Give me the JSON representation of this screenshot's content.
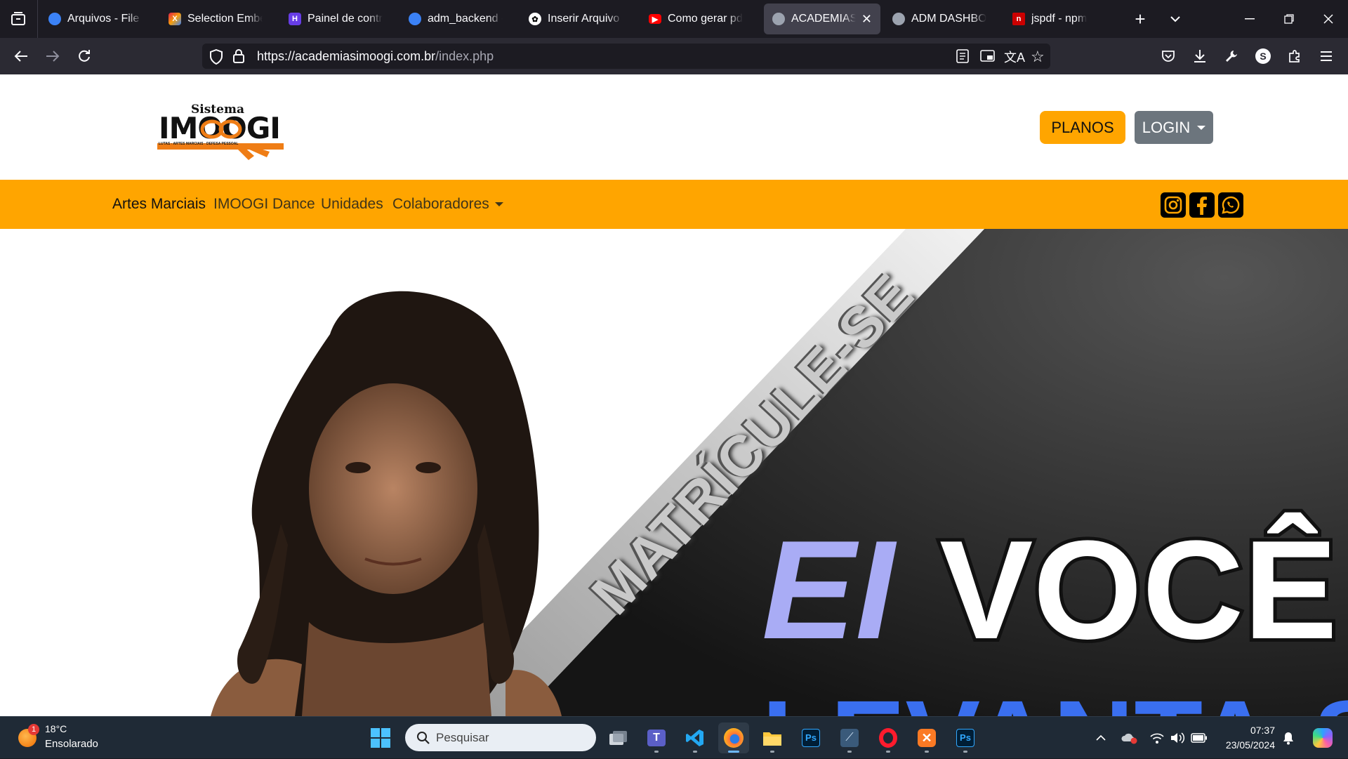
{
  "browser": {
    "tabs": [
      {
        "label": "Arquivos - File Bro",
        "favicon": "globe-icon",
        "color": "#3b82f6"
      },
      {
        "label": "Selection Embed",
        "favicon": "colorful-logo-icon",
        "color": "#e11d48"
      },
      {
        "label": "Painel de controle",
        "favicon": "h-logo-icon",
        "color": "#673de6"
      },
      {
        "label": "adm_backend - ac",
        "favicon": "globe-icon",
        "color": "#3b82f6"
      },
      {
        "label": "Inserir Arquivo Gr",
        "favicon": "openai-icon",
        "color": "#ffffff"
      },
      {
        "label": "Como gerar pdf c",
        "favicon": "youtube-icon",
        "color": "#ff0000"
      },
      {
        "label": "ACADEMIAS IM",
        "favicon": "earth-icon",
        "color": "#9ca3af",
        "active": true
      },
      {
        "label": "ADM DASHBOAR",
        "favicon": "earth-icon",
        "color": "#9ca3af"
      },
      {
        "label": "jspdf - npm",
        "favicon": "npm-icon",
        "color": "#cb0000"
      }
    ],
    "url_host": "https://academiasimoogi.com.br",
    "url_path": "/index.php"
  },
  "site": {
    "logo_top": "Sistema",
    "logo_main": "IMOOGI",
    "logo_tagline": "LUTAS - ARTES MARCIAIS - DEFESA PESSOAL",
    "planos_label": "PLANOS",
    "login_label": "LOGIN",
    "menu": [
      "Artes Marciais",
      "IMOOGI Dance",
      "Unidades",
      "Colaboradores"
    ],
    "social": [
      "instagram-icon",
      "facebook-icon",
      "whatsapp-icon"
    ],
    "accent": "#ffa500",
    "hero": {
      "banner_text": "MATRÍCULE-SE",
      "headline_1": "EI",
      "headline_2": "VOCÊ",
      "headline_3": "LEVANTA-SE"
    }
  },
  "taskbar": {
    "weather_temp": "18°C",
    "weather_desc": "Ensolarado",
    "weather_badge": "1",
    "search_placeholder": "Pesquisar",
    "time": "07:37",
    "date": "23/05/2024",
    "apps": [
      "task-view-icon",
      "teams-icon",
      "vscode-icon",
      "firefox-icon",
      "file-explorer-icon",
      "photoshop-icon",
      "sql-icon",
      "opera-icon",
      "xampp-icon",
      "photoshop-icon"
    ]
  }
}
